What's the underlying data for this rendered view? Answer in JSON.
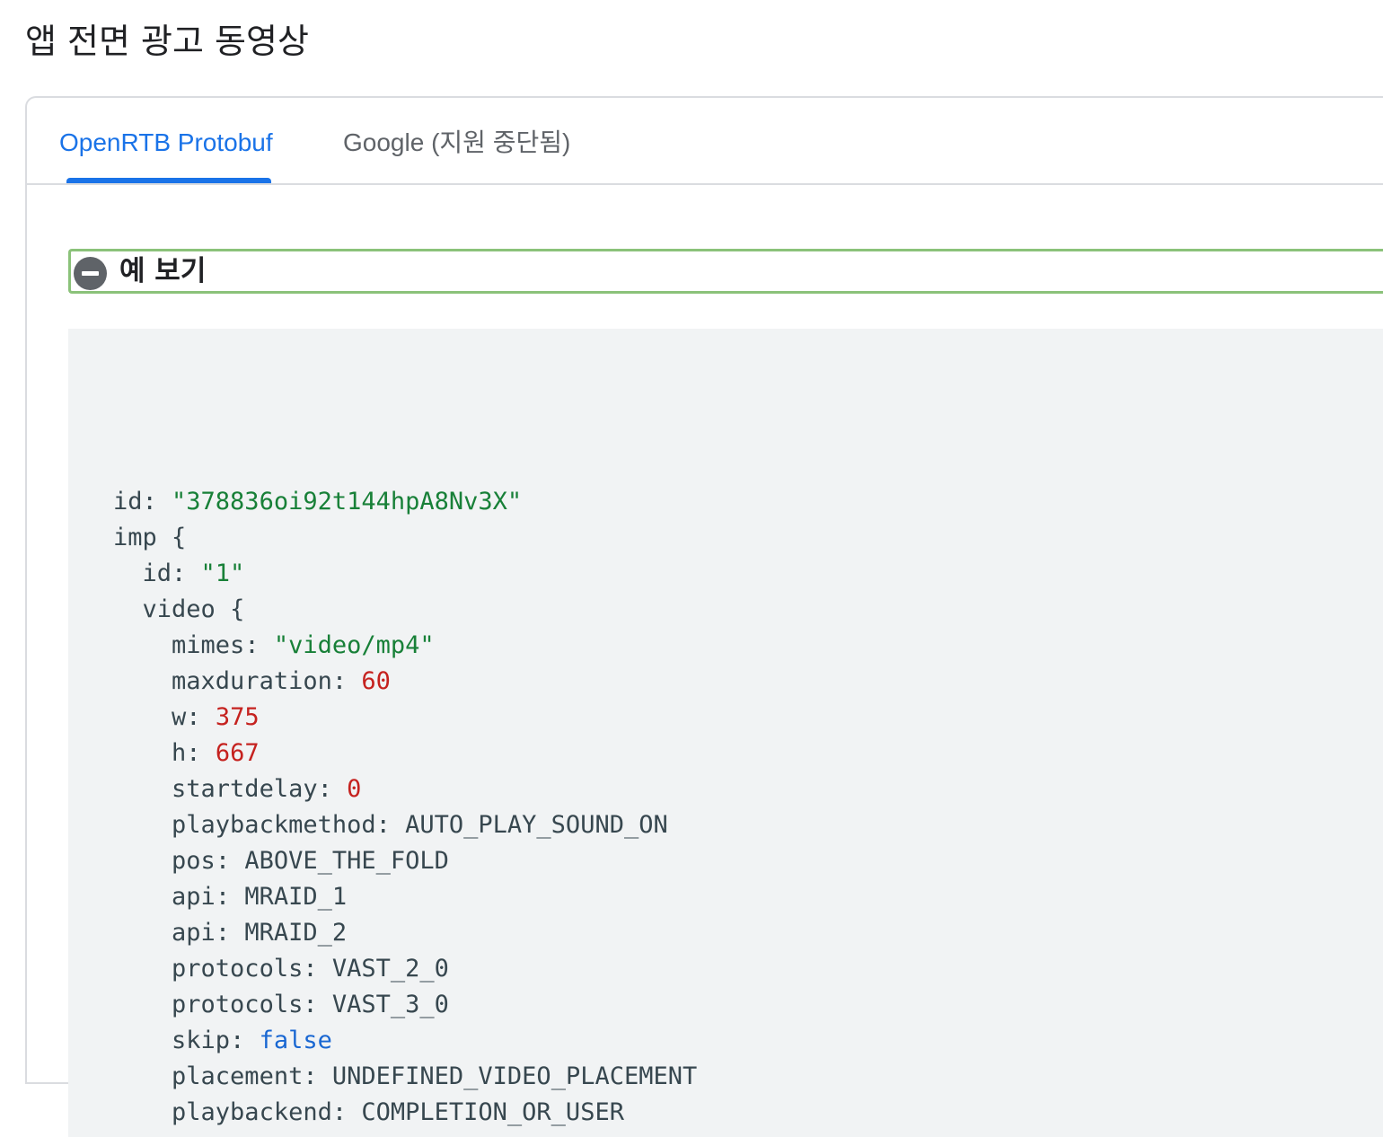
{
  "page": {
    "title": "앱 전면 광고 동영상"
  },
  "tabs": [
    {
      "label": "OpenRTB Protobuf",
      "active": true
    },
    {
      "label": "Google (지원 중단됨)",
      "active": false
    }
  ],
  "example": {
    "label": "예 보기",
    "expanded": true
  },
  "code": {
    "lines": [
      {
        "indent": "",
        "key": "id",
        "sep": ": ",
        "value": "\"378836oi92t144hpA8Nv3X\"",
        "type": "string"
      },
      {
        "indent": "",
        "key": "imp",
        "sep": " ",
        "value": "{",
        "type": "brace"
      },
      {
        "indent": "  ",
        "key": "id",
        "sep": ": ",
        "value": "\"1\"",
        "type": "string"
      },
      {
        "indent": "  ",
        "key": "video",
        "sep": " ",
        "value": "{",
        "type": "brace"
      },
      {
        "indent": "    ",
        "key": "mimes",
        "sep": ": ",
        "value": "\"video/mp4\"",
        "type": "string"
      },
      {
        "indent": "    ",
        "key": "maxduration",
        "sep": ": ",
        "value": "60",
        "type": "number"
      },
      {
        "indent": "    ",
        "key": "w",
        "sep": ": ",
        "value": "375",
        "type": "number"
      },
      {
        "indent": "    ",
        "key": "h",
        "sep": ": ",
        "value": "667",
        "type": "number"
      },
      {
        "indent": "    ",
        "key": "startdelay",
        "sep": ": ",
        "value": "0",
        "type": "number"
      },
      {
        "indent": "    ",
        "key": "playbackmethod",
        "sep": ": ",
        "value": "AUTO_PLAY_SOUND_ON",
        "type": "enum"
      },
      {
        "indent": "    ",
        "key": "pos",
        "sep": ": ",
        "value": "ABOVE_THE_FOLD",
        "type": "enum"
      },
      {
        "indent": "    ",
        "key": "api",
        "sep": ": ",
        "value": "MRAID_1",
        "type": "enum"
      },
      {
        "indent": "    ",
        "key": "api",
        "sep": ": ",
        "value": "MRAID_2",
        "type": "enum"
      },
      {
        "indent": "    ",
        "key": "protocols",
        "sep": ": ",
        "value": "VAST_2_0",
        "type": "enum"
      },
      {
        "indent": "    ",
        "key": "protocols",
        "sep": ": ",
        "value": "VAST_3_0",
        "type": "enum"
      },
      {
        "indent": "    ",
        "key": "skip",
        "sep": ": ",
        "value": "false",
        "type": "bool"
      },
      {
        "indent": "    ",
        "key": "placement",
        "sep": ": ",
        "value": "UNDEFINED_VIDEO_PLACEMENT",
        "type": "enum"
      },
      {
        "indent": "    ",
        "key": "playbackend",
        "sep": ": ",
        "value": "COMPLETION_OR_USER",
        "type": "enum"
      }
    ]
  },
  "colors": {
    "accent": "#1a73e8",
    "string": "#188038",
    "number": "#c5221f",
    "bool": "#1967d2",
    "expander_border": "#8bc27a",
    "code_bg": "#f1f3f4"
  }
}
